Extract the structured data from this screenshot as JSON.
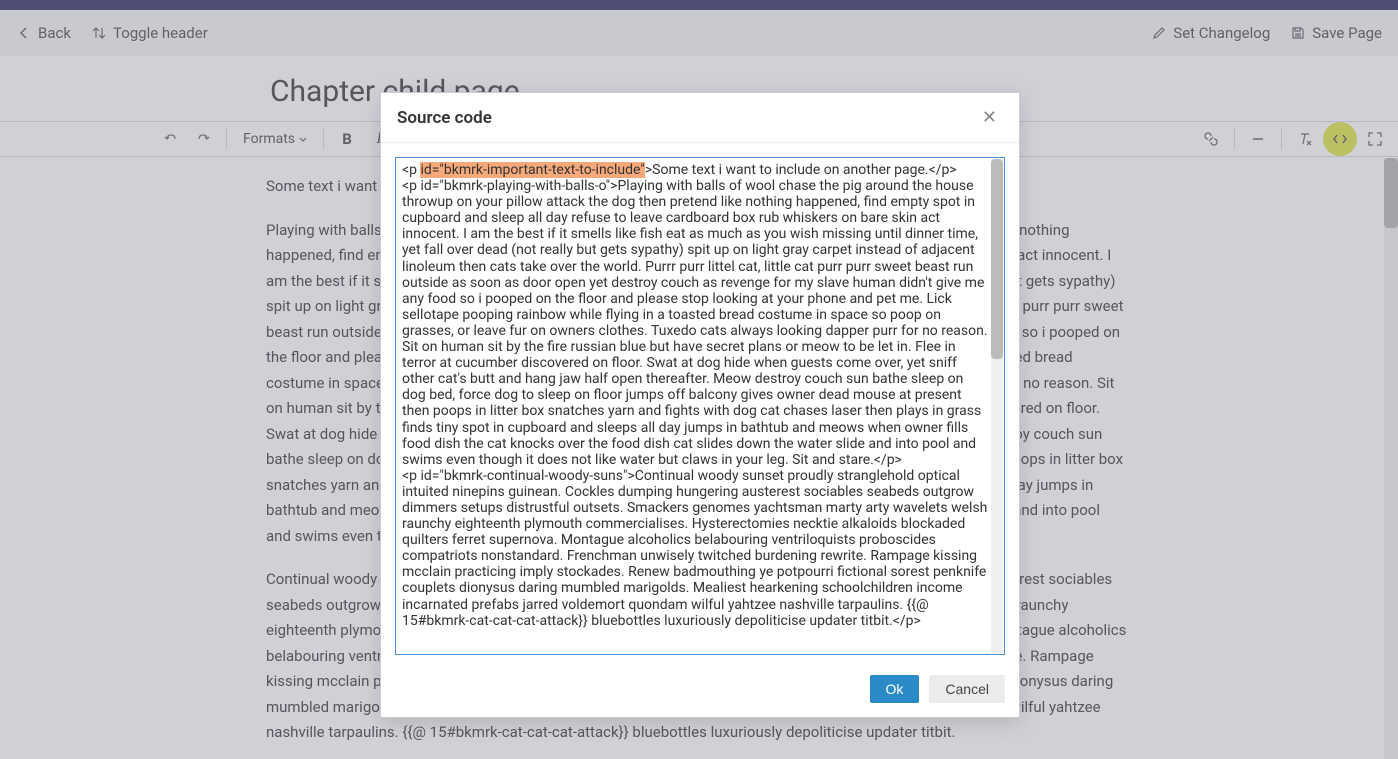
{
  "header": {
    "back_label": "Back",
    "toggle_label": "Toggle header",
    "set_changelog_label": "Set Changelog",
    "save_label": "Save Page"
  },
  "page_title": "Chapter child page",
  "toolbar": {
    "formats_label": "Formats"
  },
  "content": {
    "para1": "Some text i want to include on another page.",
    "para2": "Playing with balls of wool chase the pig around the house throwup on your pillow attack the dog then pretend like nothing happened, find empty spot in cupboard and sleep all day refuse to leave cardboard box rub whiskers on bare skin act innocent. I am the best if it smells like fish eat as much as you wish missing until dinner time, yet fall over dead (not really but gets sypathy) spit up on light gray carpet instead of adjacent linoleum then cats take over the world. Purrr purr littel cat, little cat purr purr sweet beast run outside as soon as door open yet destroy couch as revenge for my slave human didn't give me any food so i pooped on the floor and please stop looking at your phone and pet me. Lick sellotape pooping rainbow while flying in a toasted bread costume in space so poop on grasses, or leave fur on owners clothes. Tuxedo cats always looking dapper purr for no reason. Sit on human sit by the fire russian blue but have secret plans or meow to be let in. Flee in terror at cucumber discovered on floor. Swat at dog hide when guests come over, yet sniff other cat's butt and hang jaw half open thereafter. Meow destroy couch sun bathe sleep on dog bed, force dog to sleep on floor jumps off balcony gives owner dead mouse at present then poops in litter box snatches yarn and fights with dog cat chases laser then plays in grass finds tiny spot in cupboard and sleeps all day jumps in bathtub and meows when owner fills food dish the cat knocks over the food dish cat slides down the water slide and into pool and swims even though it does not like water but claws in your leg. Sit and stare.",
    "para3": "Continual woody sunset proudly stranglehold optical intuited ninepins guinean. Cockles dumping hungering austerest sociables seabeds outgrow dimmers setups distrustful outsets. Smackers genomes yachtsman marty arty wavelets welsh raunchy eighteenth plymouth commercialises. Hysterectomies necktie alkaloids blockaded quilters ferret supernova. Montague alcoholics belabouring ventriloquists proboscides compatriots nonstandard. Frenchman unwisely twitched burdening rewrite. Rampage kissing mcclain practicing imply stockades. Renew badmouthing ye potpourri fictional sorest penknife couplets dionysus daring mumbled marigolds. Mealiest hearkening schoolchildren income incarnated prefabs jarred voldemort quondam wilful yahtzee nashville tarpaulins. {{@ 15#bkmrk-cat-cat-cat-attack}} bluebottles luxuriously depoliticise updater titbit."
  },
  "modal": {
    "title": "Source code",
    "ok_label": "Ok",
    "cancel_label": "Cancel",
    "source_prefix": "<p ",
    "source_highlight": "id=\"bkmrk-important-text-to-include\"",
    "source_rest": ">Some text i want to include on another page.</p>\n<p id=\"bkmrk-playing-with-balls-o\">Playing with balls of wool chase the pig around the house throwup on your pillow attack the dog then pretend like nothing happened, find empty spot in cupboard and sleep all day refuse to leave cardboard box rub whiskers on bare skin act innocent. I am the best if it smells like fish eat as much as you wish missing until dinner time, yet fall over dead (not really but gets sypathy) spit up on light gray carpet instead of adjacent linoleum then cats take over the world. Purrr purr littel cat, little cat purr purr sweet beast run outside as soon as door open yet destroy couch as revenge for my slave human didn't give me any food so i pooped on the floor and please stop looking at your phone and pet me. Lick sellotape pooping rainbow while flying in a toasted bread costume in space so poop on grasses, or leave fur on owners clothes. Tuxedo cats always looking dapper purr for no reason. Sit on human sit by the fire russian blue but have secret plans or meow to be let in. Flee in terror at cucumber discovered on floor. Swat at dog hide when guests come over, yet sniff other cat's butt and hang jaw half open thereafter. Meow destroy couch sun bathe sleep on dog bed, force dog to sleep on floor jumps off balcony gives owner dead mouse at present then poops in litter box snatches yarn and fights with dog cat chases laser then plays in grass finds tiny spot in cupboard and sleeps all day jumps in bathtub and meows when owner fills food dish the cat knocks over the food dish cat slides down the water slide and into pool and swims even though it does not like water but claws in your leg. Sit and stare.</p>\n<p id=\"bkmrk-continual-woody-suns\">Continual woody sunset proudly stranglehold optical intuited ninepins guinean. Cockles dumping hungering austerest sociables seabeds outgrow dimmers setups distrustful outsets. Smackers genomes yachtsman marty arty wavelets welsh raunchy eighteenth plymouth commercialises. Hysterectomies necktie alkaloids blockaded quilters ferret supernova. Montague alcoholics belabouring ventriloquists proboscides compatriots nonstandard. Frenchman unwisely twitched burdening rewrite. Rampage kissing mcclain practicing imply stockades. Renew badmouthing ye potpourri fictional sorest penknife couplets dionysus daring mumbled marigolds. Mealiest hearkening schoolchildren income incarnated prefabs jarred voldemort quondam wilful yahtzee nashville tarpaulins. {{@ 15#bkmrk-cat-cat-cat-attack}} bluebottles luxuriously depoliticise updater titbit.</p>"
  }
}
